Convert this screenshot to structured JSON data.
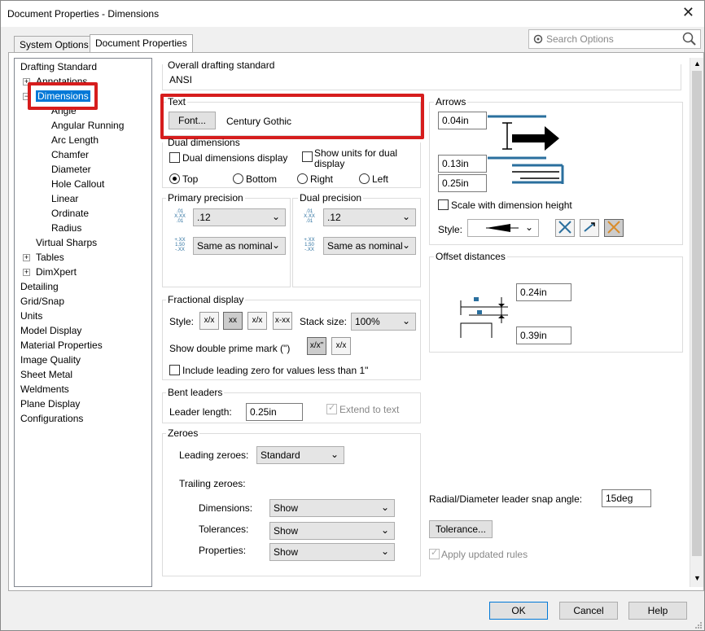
{
  "window": {
    "title": "Document Properties - Dimensions",
    "close_glyph": "✕"
  },
  "tabs": [
    "System Options",
    "Document Properties"
  ],
  "search": {
    "placeholder": "Search Options"
  },
  "tree": {
    "items": [
      "Drafting Standard",
      "Annotations",
      "Dimensions",
      "Angle",
      "Angular Running",
      "Arc Length",
      "Chamfer",
      "Diameter",
      "Hole Callout",
      "Linear",
      "Ordinate",
      "Radius",
      "Virtual Sharps",
      "Tables",
      "DimXpert",
      "Detailing",
      "Grid/Snap",
      "Units",
      "Model Display",
      "Material Properties",
      "Image Quality",
      "Sheet Metal",
      "Weldments",
      "Plane Display",
      "Configurations"
    ]
  },
  "overall": {
    "label": "Overall drafting standard",
    "value": "ANSI"
  },
  "text": {
    "label": "Text",
    "font_button": "Font...",
    "font_name": "Century Gothic"
  },
  "dual": {
    "label": "Dual dimensions",
    "display": "Dual dimensions display",
    "show_units_l1": "Show units for dual",
    "show_units_l2": "display",
    "radios": [
      "Top",
      "Bottom",
      "Right",
      "Left"
    ]
  },
  "primary_precision": {
    "label": "Primary precision",
    "value1": ".12",
    "value2": "Same as nominal"
  },
  "dual_precision": {
    "label": "Dual precision",
    "value1": ".12",
    "value2": "Same as nominal"
  },
  "precision_icon": {
    "l1": ".01",
    "l2": "X.XX",
    "l3": ".01",
    "t1": "+.XX",
    "t2": "1.50",
    "t3": "-.XX"
  },
  "fractional": {
    "label": "Fractional display",
    "style_label": "Style:",
    "stack_label": "Stack size:",
    "stack_value": "100%",
    "prime_label": "Show double prime mark (\")",
    "leading_zero": "Include leading zero for values less than 1\""
  },
  "frac_icons": [
    "x/x",
    "xx",
    "x/x",
    "x-xx",
    "x/x\"",
    "x/x"
  ],
  "bent": {
    "label": "Bent leaders",
    "length_label": "Leader length:",
    "length_value": "0.25in",
    "extend": "Extend to text"
  },
  "zeroes": {
    "label": "Zeroes",
    "leading_label": "Leading zeroes:",
    "leading_value": "Standard",
    "trailing_label": "Trailing zeroes:",
    "rows": [
      {
        "label": "Dimensions:",
        "value": "Show"
      },
      {
        "label": "Tolerances:",
        "value": "Show"
      },
      {
        "label": "Properties:",
        "value": "Show"
      }
    ]
  },
  "arrows": {
    "label": "Arrows",
    "v1": "0.04in",
    "v2": "0.13in",
    "v3": "0.25in",
    "scale": "Scale with dimension height",
    "style_label": "Style:"
  },
  "offset": {
    "label": "Offset distances",
    "v1": "0.24in",
    "v2": "0.39in"
  },
  "radial": {
    "label": "Radial/Diameter leader snap angle:",
    "value": "15deg"
  },
  "tolerance_button": "Tolerance...",
  "apply_rules": "Apply updated rules",
  "buttons": {
    "ok": "OK",
    "cancel": "Cancel",
    "help": "Help"
  },
  "colors": {
    "accent": "#0078d7",
    "highlight": "#d61d1d",
    "diagram": "#2a6f9e"
  }
}
